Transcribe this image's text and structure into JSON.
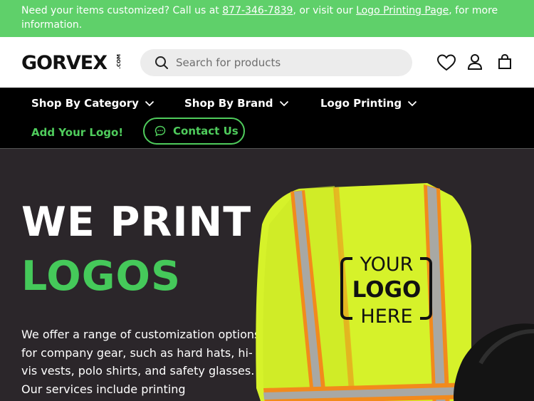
{
  "announcement": {
    "text_before": "Need your items customized? Call us at ",
    "phone": "877-346-7839",
    "text_middle": ", or visit our ",
    "link": "Logo Printing Page",
    "text_after": ", for more information."
  },
  "header": {
    "logo": "GORVEX",
    "logo_suffix": ".COM",
    "search_placeholder": "Search for products"
  },
  "nav": {
    "items": [
      {
        "label": "Shop By Category"
      },
      {
        "label": "Shop By Brand"
      },
      {
        "label": "Logo Printing"
      }
    ],
    "add_logo": "Add Your Logo!",
    "contact": "Contact Us"
  },
  "hero": {
    "title_line1": "WE PRINT",
    "title_line2": "LOGOS",
    "description": "We offer a range of customization options for company gear, such as hard hats, hi-vis vests, polo shirts, and safety glasses. Our services include printing",
    "vest_logo": [
      "YOUR",
      "LOGO",
      "HERE"
    ]
  },
  "colors": {
    "announcement_bg": "#5fd06a",
    "accent_green": "#45c95a",
    "nav_bg": "#000000",
    "hero_bg": "#2b262a",
    "vest_yellow": "#d6f22a",
    "vest_orange": "#f28a1c"
  }
}
